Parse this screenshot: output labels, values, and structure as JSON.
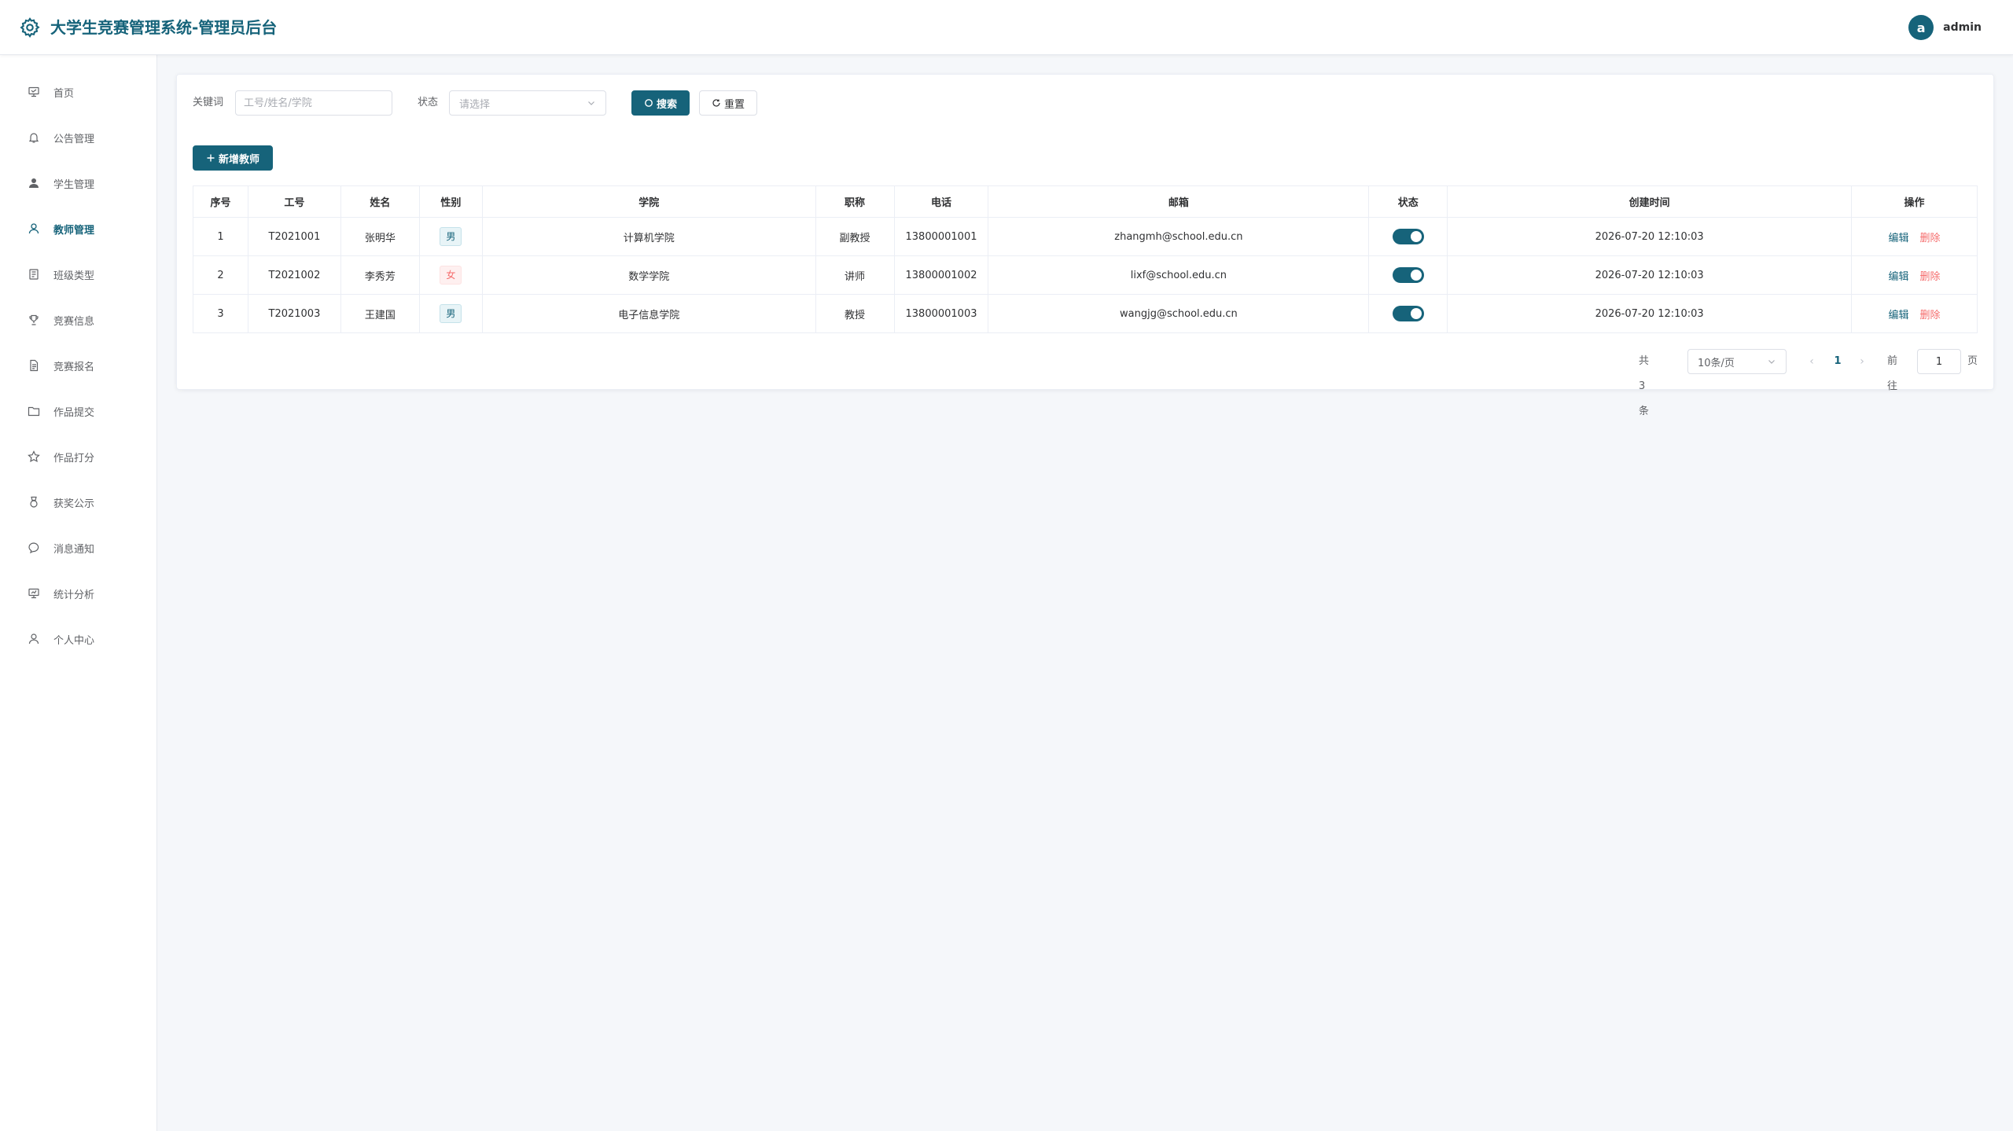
{
  "header": {
    "title": "大学生竞赛管理系统-管理员后台",
    "avatar_letter": "a",
    "username": "admin",
    "logo_icon": "gear-icon",
    "accent_color": "#16637a"
  },
  "sidebar": {
    "items": [
      {
        "label": "首页",
        "icon": "home-icon",
        "active": false
      },
      {
        "label": "公告管理",
        "icon": "bell-icon",
        "active": false
      },
      {
        "label": "学生管理",
        "icon": "user-solid-icon",
        "active": false
      },
      {
        "label": "教师管理",
        "icon": "user-icon",
        "active": true
      },
      {
        "label": "班级类型",
        "icon": "class-icon",
        "active": false
      },
      {
        "label": "竞赛信息",
        "icon": "trophy-icon",
        "active": false
      },
      {
        "label": "竞赛报名",
        "icon": "document-icon",
        "active": false
      },
      {
        "label": "作品提交",
        "icon": "folder-icon",
        "active": false
      },
      {
        "label": "作品打分",
        "icon": "star-icon",
        "active": false
      },
      {
        "label": "获奖公示",
        "icon": "medal-icon",
        "active": false
      },
      {
        "label": "消息通知",
        "icon": "chat-icon",
        "active": false
      },
      {
        "label": "统计分析",
        "icon": "chart-board-icon",
        "active": false
      },
      {
        "label": "个人中心",
        "icon": "profile-icon",
        "active": false
      }
    ]
  },
  "filters": {
    "keyword_label": "关键词",
    "keyword_placeholder": "工号/姓名/学院",
    "keyword_value": "",
    "status_label": "状态",
    "status_placeholder": "请选择",
    "search_label": "搜索",
    "reset_label": "重置"
  },
  "toolbar": {
    "add_label": "新增教师"
  },
  "table": {
    "columns": [
      "序号",
      "工号",
      "姓名",
      "性别",
      "学院",
      "职称",
      "电话",
      "邮箱",
      "状态",
      "创建时间",
      "操作"
    ],
    "rows": [
      {
        "index": "1",
        "id": "T2021001",
        "name": "张明华",
        "gender": "男",
        "college": "计算机学院",
        "title": "副教授",
        "phone": "13800001001",
        "email": "zhangmh@school.edu.cn",
        "enabled": true,
        "created": "2026-07-20 12:10:03",
        "edit": "编辑",
        "delete": "删除"
      },
      {
        "index": "2",
        "id": "T2021002",
        "name": "李秀芳",
        "gender": "女",
        "college": "数学学院",
        "title": "讲师",
        "phone": "13800001002",
        "email": "lixf@school.edu.cn",
        "enabled": true,
        "created": "2026-07-20 12:10:03",
        "edit": "编辑",
        "delete": "删除"
      },
      {
        "index": "3",
        "id": "T2021003",
        "name": "王建国",
        "gender": "男",
        "college": "电子信息学院",
        "title": "教授",
        "phone": "13800001003",
        "email": "wangjg@school.edu.cn",
        "enabled": true,
        "created": "2026-07-20 12:10:03",
        "edit": "编辑",
        "delete": "删除"
      }
    ]
  },
  "pagination": {
    "total_text": "共 3 条",
    "page_size": "10条/页",
    "current_page": "1",
    "goto_label": "前往",
    "goto_value": "1",
    "page_unit": "页"
  }
}
